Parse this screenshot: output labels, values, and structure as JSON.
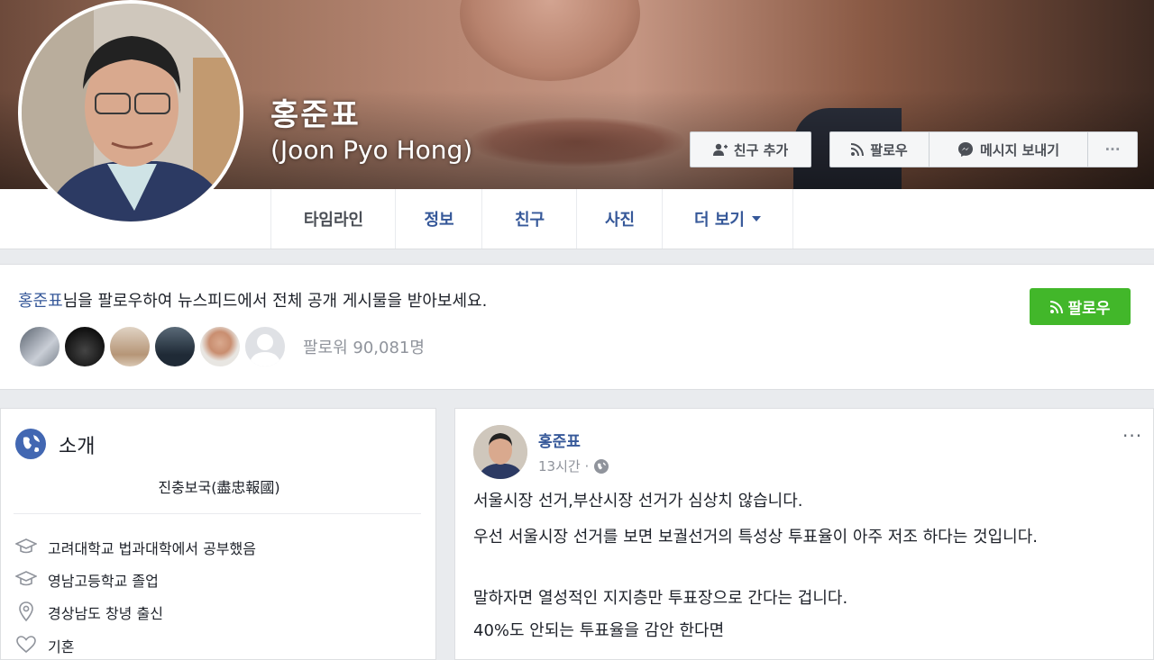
{
  "profile": {
    "name": "홍준표",
    "alt_name": "(Joon Pyo Hong)"
  },
  "actions": {
    "add_friend": "친구 추가",
    "follow": "팔로우",
    "message": "메시지 보내기",
    "more": "···"
  },
  "tabs": [
    "타임라인",
    "정보",
    "친구",
    "사진",
    "더 보기"
  ],
  "follow_card": {
    "name": "홍준표",
    "suffix": "님을 팔로우하여 뉴스피드에서 전체 공개 게시물을 받아보세요.",
    "button": "팔로우",
    "followers": "팔로워 90,081명"
  },
  "intro": {
    "title": "소개",
    "motto": "진충보국(盡忠報國)",
    "items": [
      {
        "icon": "graduation-cap-icon",
        "text": "고려대학교 법과대학에서 공부했음"
      },
      {
        "icon": "graduation-cap-icon",
        "text": "영남고등학교 졸업"
      },
      {
        "icon": "location-pin-icon",
        "text": "경상남도 창녕 출신"
      },
      {
        "icon": "heart-icon",
        "text": "기혼"
      }
    ]
  },
  "post": {
    "author": "홍준표",
    "time": "13시간 ·",
    "more": "···",
    "lines": [
      "서울시장 선거,부산시장 선거가 심상치 않습니다.",
      "우선 서울시장 선거를 보면 보궐선거의 특성상 투표율이 아주 저조 하다는 것입니다.",
      "말하자면 열성적인 지지층만 투표장으로 간다는 겁니다.",
      "40%도 안되는 투표율을 감안 한다면"
    ]
  },
  "colors": {
    "link_blue": "#365899",
    "follow_green": "#42b72a",
    "bg_gray": "#e9ebee"
  }
}
